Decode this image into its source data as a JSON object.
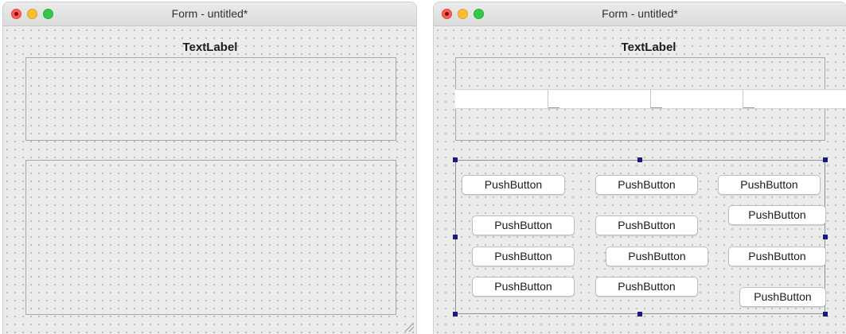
{
  "left_window": {
    "title": "Form - untitled*",
    "label_text": "TextLabel"
  },
  "right_window": {
    "title": "Form - untitled*",
    "label_text": "TextLabel",
    "buttons": [
      {
        "label": "PushButton"
      },
      {
        "label": "PushButton"
      },
      {
        "label": "PushButton"
      },
      {
        "label": "PushButton"
      },
      {
        "label": "PushButton"
      },
      {
        "label": "PushButton"
      },
      {
        "label": "PushButton"
      },
      {
        "label": "PushButton"
      },
      {
        "label": "PushButton"
      },
      {
        "label": "PushButton"
      },
      {
        "label": "PushButton"
      },
      {
        "label": "PushButton"
      }
    ]
  },
  "colors": {
    "close": "#fd5b55",
    "minimize": "#fcbd2e",
    "maximize": "#34c84a",
    "selection_handle": "#1a1a7c"
  }
}
